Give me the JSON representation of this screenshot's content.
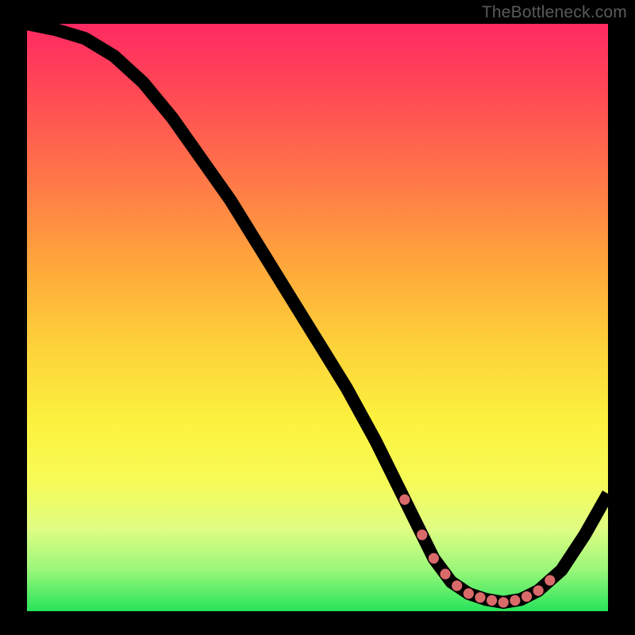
{
  "watermark": "TheBottleneck.com",
  "colors": {
    "frame": "#000000",
    "gradient_top": "#ff2a63",
    "gradient_mid": "#fcf23e",
    "gradient_bottom": "#27e35a",
    "curve": "#000000",
    "markers": "#d96a6a"
  },
  "chart_data": {
    "type": "line",
    "title": "",
    "xlabel": "",
    "ylabel": "",
    "xlim": [
      0,
      100
    ],
    "ylim": [
      0,
      100
    ],
    "x": [
      0,
      5,
      10,
      15,
      20,
      25,
      30,
      35,
      40,
      45,
      50,
      55,
      60,
      65,
      68,
      70,
      73,
      76,
      79,
      82,
      85,
      88,
      92,
      96,
      100
    ],
    "values": [
      100,
      99,
      97.5,
      94.5,
      90,
      84,
      77,
      70,
      62,
      54,
      46,
      38,
      29,
      19,
      13,
      9,
      5,
      3,
      2,
      1.5,
      2,
      3.5,
      7,
      13,
      20
    ],
    "marker_x": [
      65,
      68,
      70,
      72,
      74,
      76,
      78,
      80,
      82,
      84,
      86,
      88,
      90
    ]
  }
}
